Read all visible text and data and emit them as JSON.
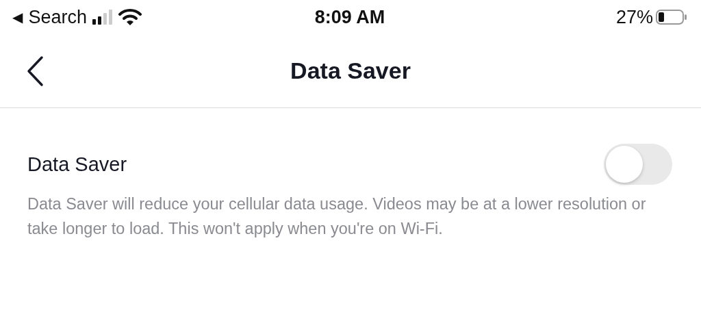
{
  "status_bar": {
    "back_glyph": "◀",
    "back_label": "Search",
    "time": "8:09 AM",
    "battery": "27%"
  },
  "nav_bar": {
    "title": "Data Saver"
  },
  "settings": [
    {
      "kind": "toggle",
      "label": "Data Saver",
      "on": false,
      "description": "Data Saver will reduce your cellular data usage. Videos may be at a lower resolution or take longer to load. This won't apply when you're on Wi-Fi."
    }
  ]
}
